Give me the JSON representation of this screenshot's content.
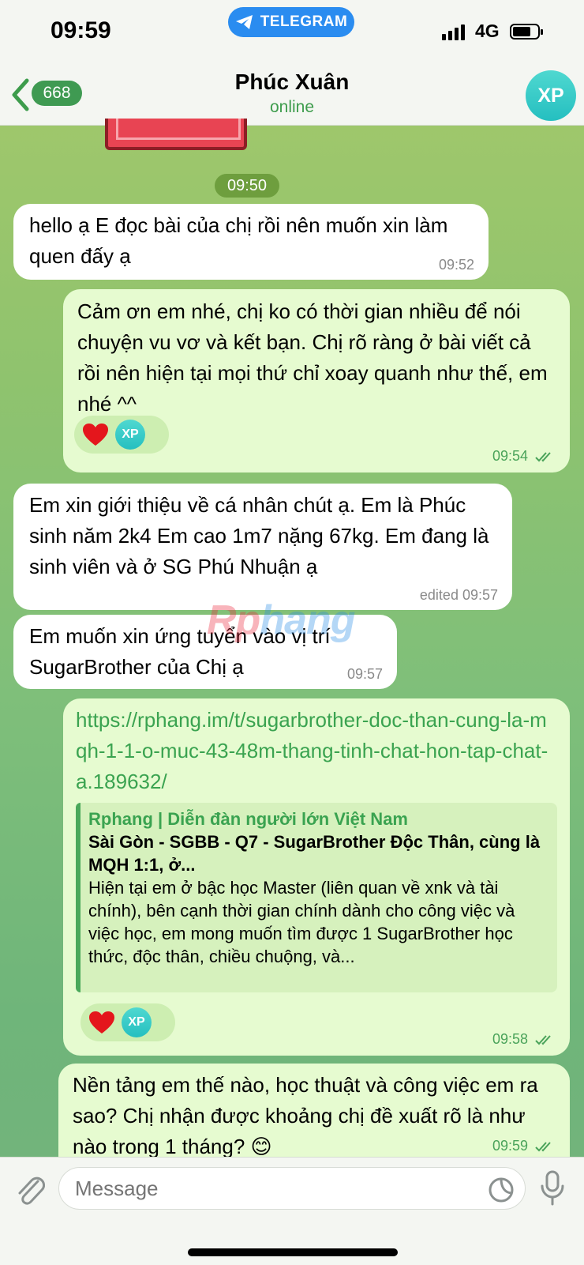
{
  "status_bar": {
    "time": "09:59",
    "app_pill": "TELEGRAM",
    "network": "4G"
  },
  "header": {
    "back_count": "668",
    "title": "Phúc Xuân",
    "status": "online",
    "avatar_initials": "XP"
  },
  "date_label": "09:50",
  "messages": [
    {
      "direction": "in",
      "text": "hello ạ E đọc bài của chị rồi nên muốn xin làm quen đấy ạ",
      "time": "09:52"
    },
    {
      "direction": "out",
      "text": "Cảm ơn em nhé, chị ko có thời gian nhiều để nói chuyện vu vơ và kết bạn. Chị rõ ràng ở bài viết cả rồi nên hiện tại mọi thứ chỉ xoay quanh như thế, em nhé ^^",
      "time": "09:54",
      "reaction_avatar": "XP"
    },
    {
      "direction": "in",
      "text": "Em xin giới thiệu về cá nhân chút ạ. Em là Phúc sinh năm 2k4 Em cao 1m7 nặng 67kg. Em đang là sinh viên và ở SG Phú Nhuận ạ",
      "time": "edited 09:57"
    },
    {
      "direction": "in",
      "text": "Em muốn xin ứng tuyển vào vị trí SugarBrother của Chị ạ",
      "time": "09:57"
    },
    {
      "direction": "out",
      "link": "https://rphang.im/t/sugarbrother-doc-than-cung-la-mqh-1-1-o-muc-43-48m-thang-tinh-chat-hon-tap-chat-a.189632/",
      "preview_site": "Rphang | Diễn đàn người lớn Việt Nam",
      "preview_title": "Sài Gòn - SGBB - Q7 - SugarBrother Độc Thân, cùng là MQH 1:1, ở...",
      "preview_desc": "Hiện tại em ở bậc học Master (liên quan về xnk và tài chính), bên cạnh thời gian chính dành cho công việc và việc học, em mong muốn tìm được 1 SugarBrother học thức, độc thân, chiều chuộng, và...",
      "time": "09:58",
      "reaction_avatar": "XP"
    },
    {
      "direction": "out",
      "text": "Nền tảng em thế nào, học thuật và công việc em ra sao? Chị nhận được khoảng chị đề xuất rõ là như nào trong 1 tháng? 😊",
      "time": "09:59"
    }
  ],
  "watermark": {
    "part1": "Rp",
    "part2": "hang"
  },
  "input": {
    "placeholder": "Message"
  },
  "icons": [
    "telegram-icon",
    "signal-icon",
    "battery-icon",
    "back-chevron-icon",
    "heart-icon",
    "read-checks-icon",
    "attach-icon",
    "sticker-icon",
    "microphone-icon"
  ],
  "colors": {
    "accent_green": "#3d9c4c",
    "outgoing_bubble": "#e6fbd0",
    "telegram_blue": "#2a8cf0",
    "avatar": "#25bfc0"
  }
}
